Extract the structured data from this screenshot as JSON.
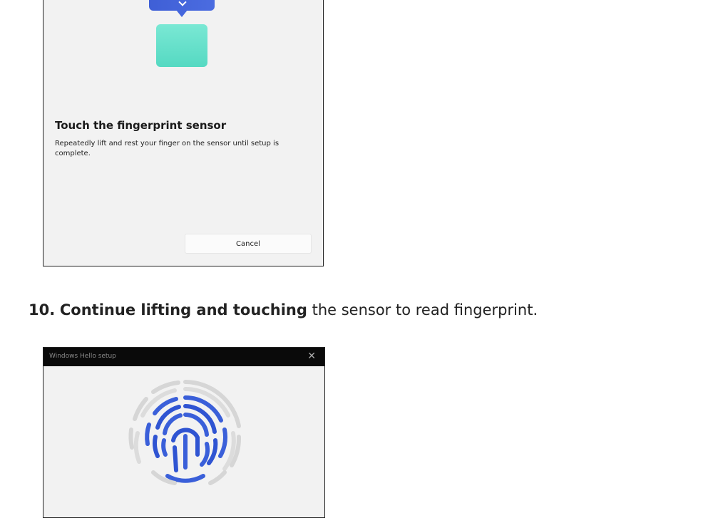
{
  "step1_dialog": {
    "title": "Touch the fingerprint sensor",
    "description": "Repeatedly lift and rest your finger on the sensor until setup is complete.",
    "cancel_label": "Cancel"
  },
  "instruction": {
    "number": "10.",
    "bold_text": "Continue lifting and touching",
    "rest_text": " the sensor to read fingerprint."
  },
  "step2_dialog": {
    "window_title": "Windows Hello setup",
    "close_glyph": "✕"
  },
  "colors": {
    "accent_blue": "#3a5fd9",
    "sensor_teal": "#5fdcc6",
    "ridge_gray": "#d4d4d4"
  }
}
